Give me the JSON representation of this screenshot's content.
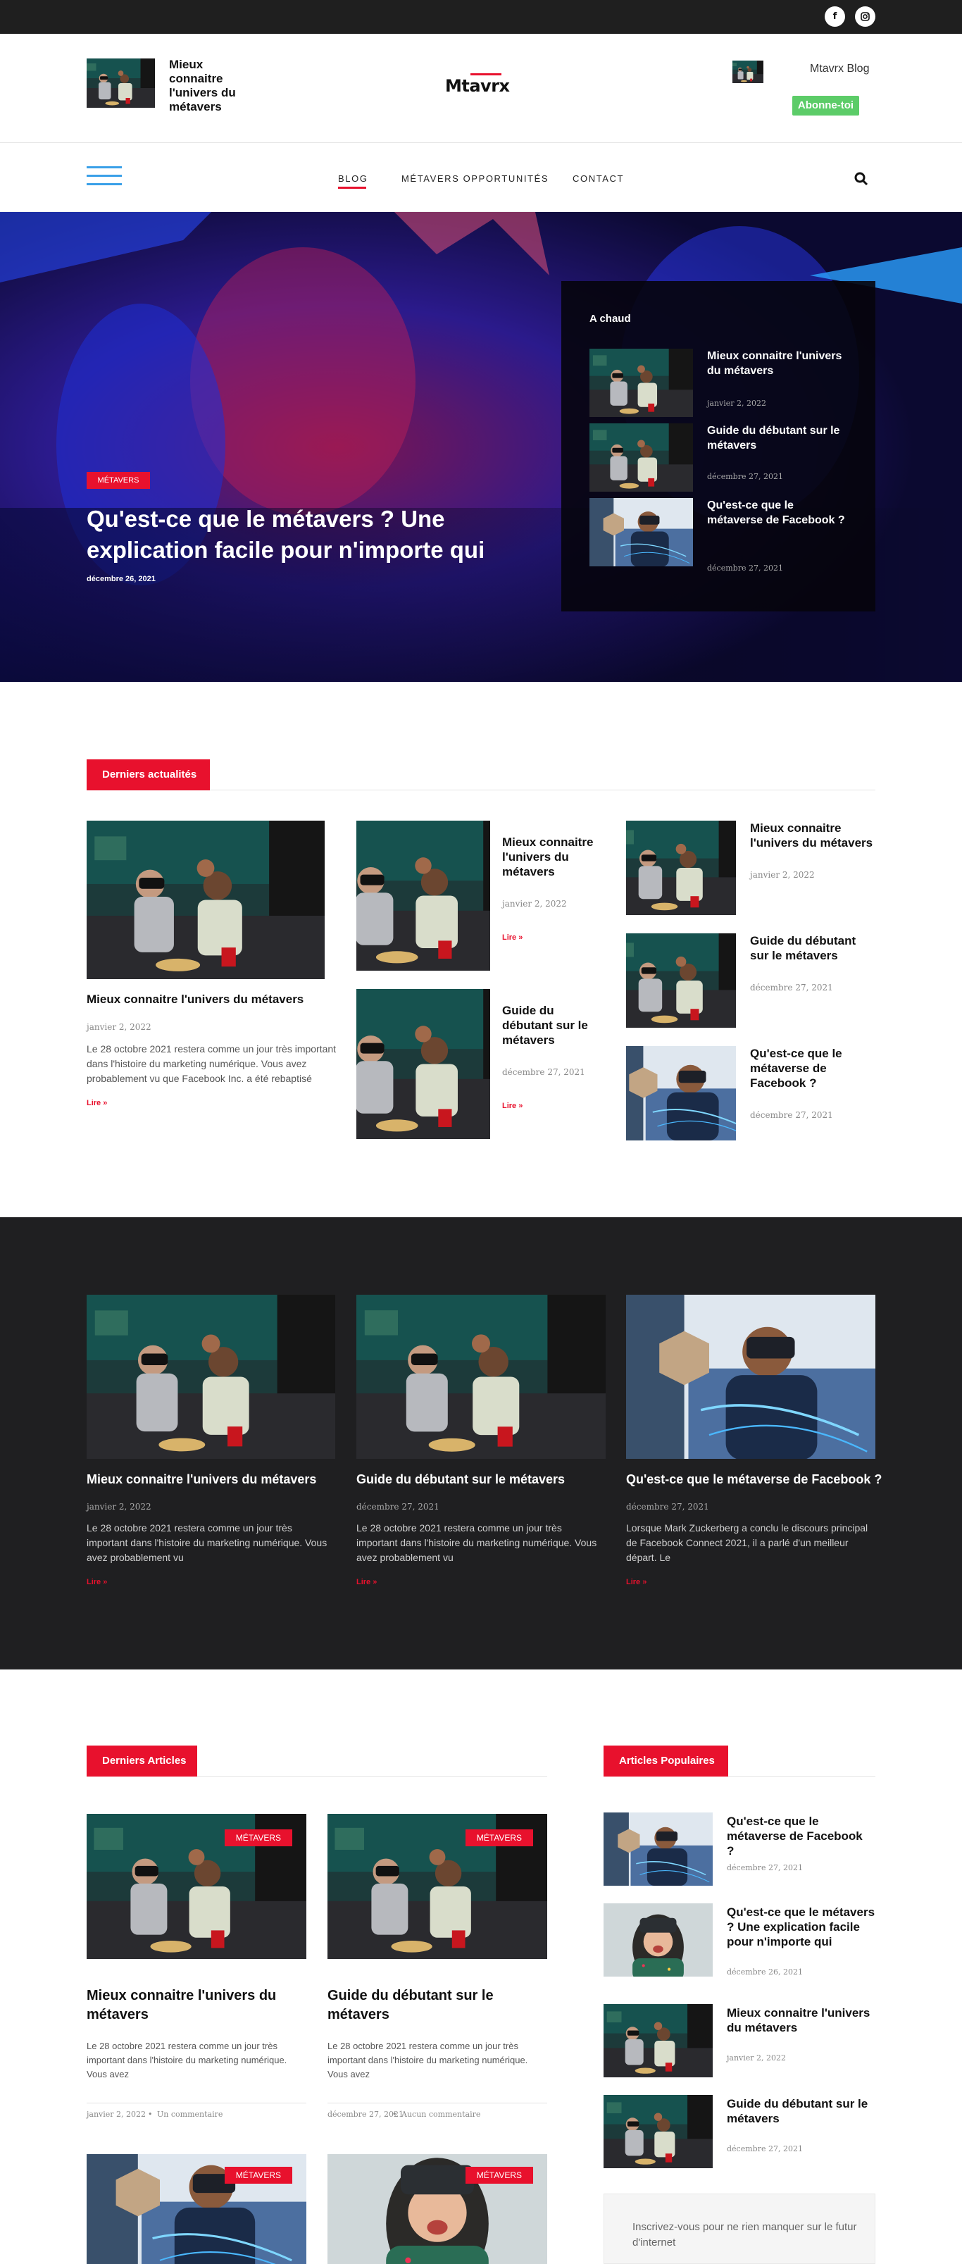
{
  "header": {
    "site_tagline": "Mieux connaitre l'univers du métavers",
    "logo_text": "Mtavrx",
    "blog_name": "Mtavrx Blog",
    "subscribe_label": "Abonne-toi",
    "social_icons": [
      "facebook-icon",
      "instagram-icon"
    ]
  },
  "nav": {
    "items": [
      "BLOG",
      "MÉTAVERS OPPORTUNITÉS",
      "CONTACT"
    ],
    "active": "BLOG"
  },
  "hero": {
    "category": "MÉTAVERS",
    "title": "Qu'est-ce que le métavers ? Une explication facile pour n'importe qui",
    "date": "décembre 26, 2021",
    "hot_title": "A chaud",
    "hot": [
      {
        "title": "Mieux connaitre l'univers du métavers",
        "date": "janvier 2, 2022"
      },
      {
        "title": "Guide du débutant sur le métavers",
        "date": "décembre 27, 2021"
      },
      {
        "title": "Qu'est-ce que le métaverse de Facebook ?",
        "date": "décembre 27, 2021"
      }
    ]
  },
  "latest_news": {
    "heading": "Derniers actualités",
    "feature": {
      "title": "Mieux connaitre l'univers du métavers",
      "date": "janvier 2, 2022",
      "excerpt": "Le 28 octobre 2021 restera comme un jour très important dans l'histoire du marketing numérique. Vous avez probablement vu que Facebook Inc. a été rebaptisé",
      "read_more": "Lire »"
    },
    "middle": [
      {
        "title": "Mieux connaitre l'univers du métavers",
        "date": "janvier 2, 2022",
        "read_more": "Lire »"
      },
      {
        "title": "Guide du débutant sur le métavers",
        "date": "décembre 27, 2021",
        "read_more": "Lire »"
      }
    ],
    "right": [
      {
        "title": "Mieux connaitre l'univers du métavers",
        "date": "janvier 2, 2022"
      },
      {
        "title": "Guide du débutant sur le métavers",
        "date": "décembre 27, 2021"
      },
      {
        "title": "Qu'est-ce que le métaverse de Facebook ?",
        "date": "décembre 27, 2021"
      }
    ]
  },
  "dark_section": [
    {
      "title": "Mieux connaitre l'univers du métavers",
      "date": "janvier 2, 2022",
      "excerpt": "Le 28 octobre 2021 restera comme un jour très important dans l'histoire du marketing numérique. Vous avez probablement vu",
      "read_more": "Lire »"
    },
    {
      "title": "Guide du débutant sur le métavers",
      "date": "décembre 27, 2021",
      "excerpt": "Le 28 octobre 2021 restera comme un jour très important dans l'histoire du marketing numérique. Vous avez probablement vu",
      "read_more": "Lire »"
    },
    {
      "title": "Qu'est-ce que le métaverse de Facebook ?",
      "date": "décembre 27, 2021",
      "excerpt": "Lorsque Mark Zuckerberg a conclu le discours principal de Facebook Connect 2021, il a parlé d'un meilleur départ. Le",
      "read_more": "Lire »"
    }
  ],
  "articles": {
    "heading": "Derniers Articles",
    "items": [
      {
        "tag": "MÉTAVERS",
        "title": "Mieux connaitre l'univers du métavers",
        "excerpt": "Le 28 octobre 2021 restera comme un jour très important dans l'histoire du marketing numérique. Vous avez",
        "date": "janvier 2, 2022",
        "comments": "Un commentaire"
      },
      {
        "tag": "MÉTAVERS",
        "title": "Guide du débutant sur le métavers",
        "excerpt": "Le 28 octobre 2021 restera comme un jour très important dans l'histoire du marketing numérique. Vous avez",
        "date": "décembre 27, 2021",
        "comments": "Aucun commentaire"
      },
      {
        "tag": "MÉTAVERS"
      },
      {
        "tag": "MÉTAVERS"
      }
    ],
    "meta_separator": "•"
  },
  "popular": {
    "heading": "Articles Populaires",
    "items": [
      {
        "title": "Qu'est-ce que le métaverse de Facebook ?",
        "date": "décembre 27, 2021"
      },
      {
        "title": "Qu'est-ce que le métavers ? Une explication facile pour n'importe qui",
        "date": "décembre 26, 2021"
      },
      {
        "title": "Mieux connaitre l'univers du métavers",
        "date": "janvier 2, 2022"
      },
      {
        "title": "Guide du débutant sur le métavers",
        "date": "décembre 27, 2021"
      }
    ]
  },
  "newsletter": {
    "text": "Inscrivez-vous pour ne rien manquer sur le futur d'internet"
  },
  "colors": {
    "accent": "#e8112d",
    "dark": "#1f1f21",
    "subscribe": "#5ccc68",
    "hamburger": "#3aa0e8"
  }
}
